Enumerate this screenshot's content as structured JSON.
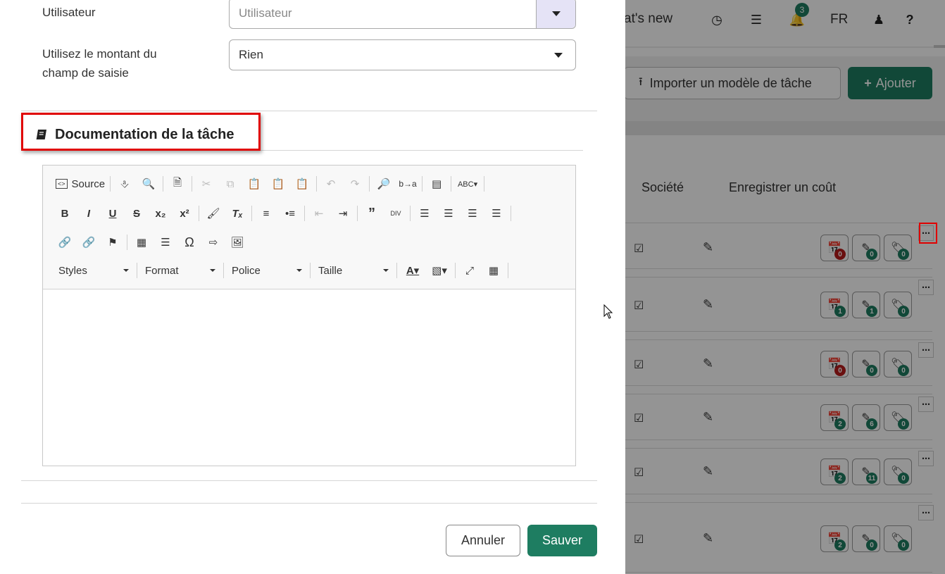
{
  "form": {
    "user_label": "Utilisateur",
    "user_placeholder": "Utilisateur",
    "amount_label_line1": "Utilisez le montant du",
    "amount_label_line2": "champ de saisie",
    "amount_value": "Rien"
  },
  "section": {
    "title": "Documentation de la tâche"
  },
  "editor": {
    "source_label": "Source",
    "combos": [
      "Styles",
      "Format",
      "Police",
      "Taille"
    ]
  },
  "footer": {
    "cancel_label": "Annuler",
    "save_label": "Sauver"
  },
  "background": {
    "whats_new": "at's new",
    "notifications_count": "3",
    "language": "FR",
    "help": "?",
    "import_label": "Importer un modèle de tâche",
    "add_label": "Ajouter",
    "col_company": "Société",
    "col_record_cost": "Enregistrer un coût",
    "rows": [
      {
        "calendar": "0",
        "edit": "0",
        "tag": "0"
      },
      {
        "calendar": "1",
        "edit": "1",
        "tag": "0"
      },
      {
        "calendar": "0",
        "edit": "0",
        "tag": "0"
      },
      {
        "calendar": "2",
        "edit": "6",
        "tag": "0"
      },
      {
        "calendar": "2",
        "edit": "11",
        "tag": "0"
      },
      {
        "calendar": "2",
        "edit": "0",
        "tag": "0"
      }
    ],
    "badge_colors": {
      "red": "#b71c1c",
      "green": "#1e7d61"
    }
  },
  "colors": {
    "accent": "#1e7d61",
    "highlight": "#e00000"
  }
}
